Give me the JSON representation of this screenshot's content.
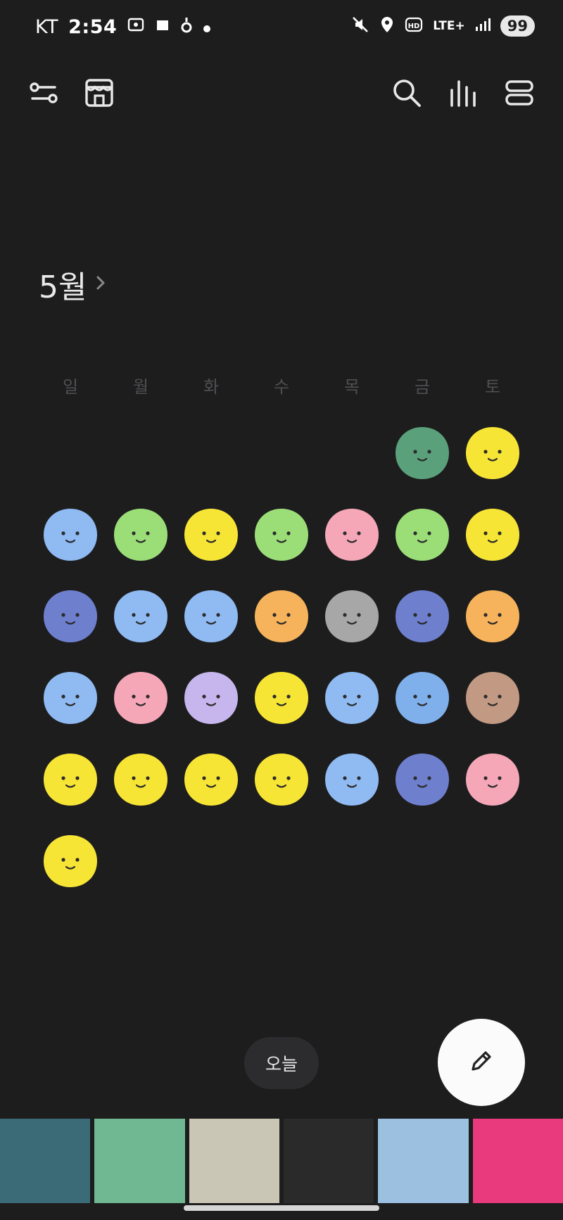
{
  "status_bar": {
    "carrier": "KT",
    "time": "2:54",
    "network": "LTE+",
    "battery": "99"
  },
  "calendar": {
    "month_label": "5월",
    "weekdays": [
      "일",
      "월",
      "화",
      "수",
      "목",
      "금",
      "토"
    ],
    "moods": [
      {
        "day": 1,
        "color": "#5aa07a"
      },
      {
        "day": 2,
        "color": "#f7e536"
      },
      {
        "day": 3,
        "color": "#8fbaf2"
      },
      {
        "day": 4,
        "color": "#9bde78"
      },
      {
        "day": 5,
        "color": "#f7e536"
      },
      {
        "day": 6,
        "color": "#9bde78"
      },
      {
        "day": 7,
        "color": "#f5a7b8"
      },
      {
        "day": 8,
        "color": "#9bde78"
      },
      {
        "day": 9,
        "color": "#f7e536"
      },
      {
        "day": 10,
        "color": "#6e7fce"
      },
      {
        "day": 11,
        "color": "#8fbaf2"
      },
      {
        "day": 12,
        "color": "#8fbaf2"
      },
      {
        "day": 13,
        "color": "#f6b35c"
      },
      {
        "day": 14,
        "color": "#a7a7a7"
      },
      {
        "day": 15,
        "color": "#6e7fce"
      },
      {
        "day": 16,
        "color": "#f6b35c"
      },
      {
        "day": 17,
        "color": "#8fbaf2"
      },
      {
        "day": 18,
        "color": "#f5a7b8"
      },
      {
        "day": 19,
        "color": "#c7b6ee"
      },
      {
        "day": 20,
        "color": "#f7e536"
      },
      {
        "day": 21,
        "color": "#8fbaf2"
      },
      {
        "day": 22,
        "color": "#7fb0ec"
      },
      {
        "day": 23,
        "color": "#c29a84"
      },
      {
        "day": 24,
        "color": "#f7e536"
      },
      {
        "day": 25,
        "color": "#f7e536"
      },
      {
        "day": 26,
        "color": "#f7e536"
      },
      {
        "day": 27,
        "color": "#f7e536"
      },
      {
        "day": 28,
        "color": "#8fbaf2"
      },
      {
        "day": 29,
        "color": "#6e7fce"
      },
      {
        "day": 30,
        "color": "#f5a7b8"
      },
      {
        "day": 31,
        "color": "#f7e536"
      }
    ]
  },
  "today_button": {
    "label": "오늘"
  },
  "ad_colors": [
    "#3c6b78",
    "#6fb891",
    "#c9c6b5",
    "#2a2a2a",
    "#9bc0e0",
    "#e83a7c"
  ]
}
